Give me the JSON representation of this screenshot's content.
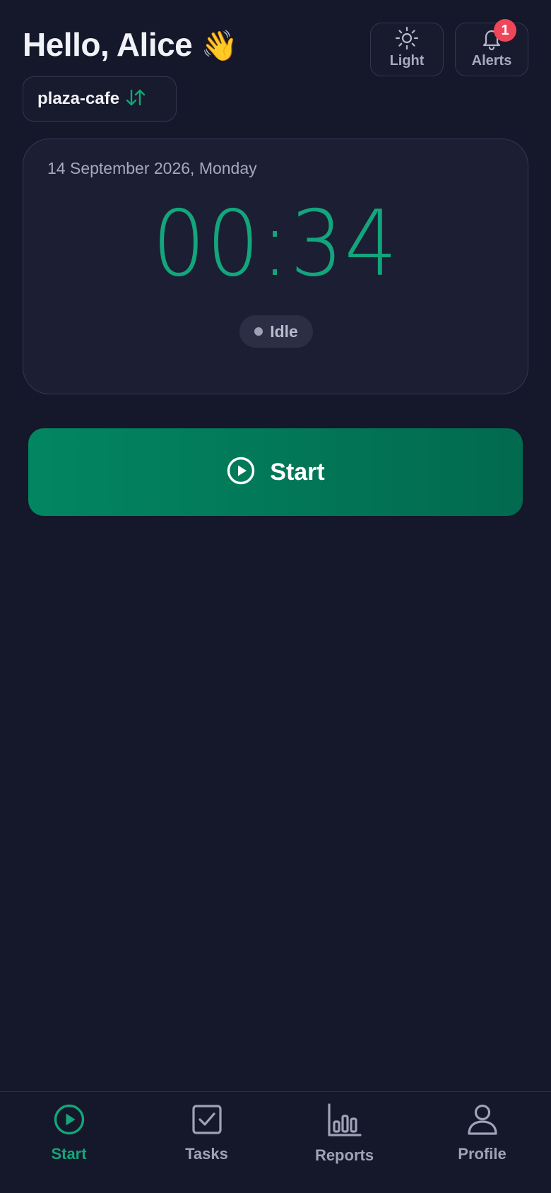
{
  "header": {
    "greeting": "Hello, Alice",
    "wave": "👋",
    "theme_label": "Light",
    "alerts_label": "Alerts",
    "alerts_count": "1"
  },
  "location": {
    "name": "plaza-cafe"
  },
  "clock": {
    "date": "14 September 2026, Monday",
    "time": "00:34",
    "status": "Idle"
  },
  "action": {
    "start_label": "Start"
  },
  "nav": {
    "items": [
      {
        "label": "Start",
        "icon": "play-circle-icon",
        "active": true
      },
      {
        "label": "Tasks",
        "icon": "checkbox-icon",
        "active": false
      },
      {
        "label": "Reports",
        "icon": "bar-chart-icon",
        "active": false
      },
      {
        "label": "Profile",
        "icon": "user-icon",
        "active": false
      }
    ]
  },
  "colors": {
    "accent": "#14a57a",
    "background": "#15172a",
    "badge": "#f04659"
  }
}
